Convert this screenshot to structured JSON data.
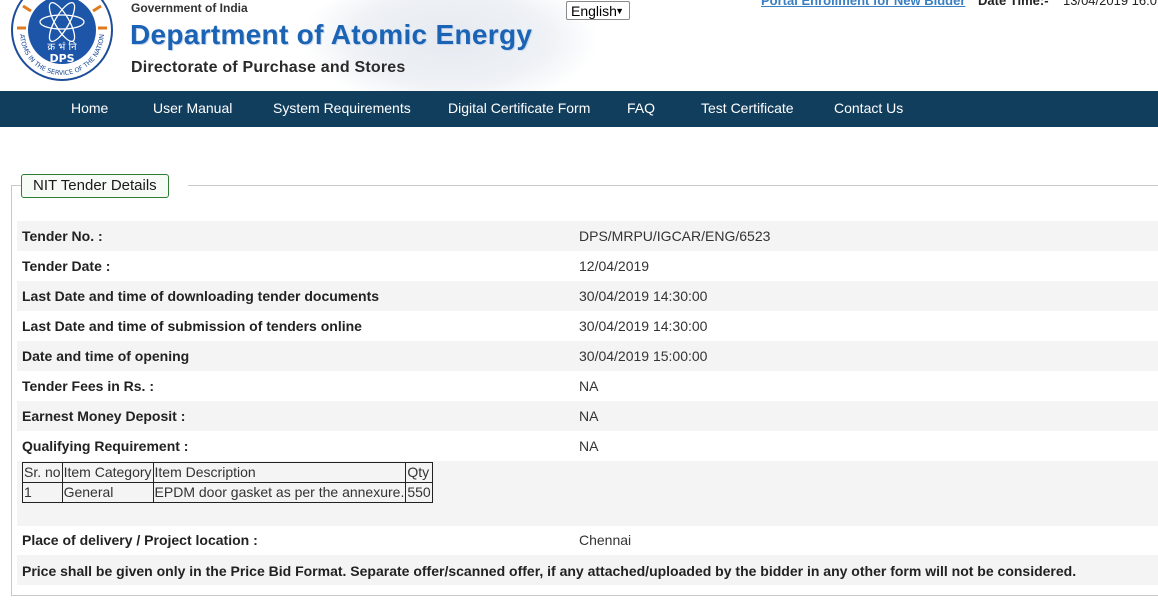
{
  "header": {
    "logo_text": "DPS",
    "logo_hindi": "क्र भं नि",
    "logo_arc_top": "परमाणु ऊर्जा राष्ट्र की सेवा में",
    "logo_arc_bottom": "ATOMS IN THE SERVICE OF THE NATION",
    "gov": "Government of India",
    "dept": "Department of Atomic Energy",
    "directorate": "Directorate of Purchase and Stores",
    "language": "English",
    "portal_link": "Portal Enrollment for New Bidder",
    "datetime_label": "Date Time:-",
    "datetime_value": "13/04/2019 16:0"
  },
  "nav": [
    "Home",
    "User Manual",
    "System Requirements",
    "Digital Certificate Form",
    "FAQ",
    "Test Certificate",
    "Contact Us"
  ],
  "section_title": "NIT Tender Details",
  "details": [
    {
      "label": "Tender No. :",
      "value": "DPS/MRPU/IGCAR/ENG/6523"
    },
    {
      "label": "Tender Date :",
      "value": "12/04/2019"
    },
    {
      "label": "Last Date and time of downloading tender documents",
      "value": "30/04/2019 14:30:00"
    },
    {
      "label": "Last Date and time of submission of tenders online",
      "value": "30/04/2019 14:30:00"
    },
    {
      "label": "Date and time of opening",
      "value": "30/04/2019 15:00:00"
    },
    {
      "label": "Tender Fees in Rs. :",
      "value": "NA"
    },
    {
      "label": "Earnest Money Deposit :",
      "value": "NA"
    },
    {
      "label": "Qualifying Requirement :",
      "value": "NA"
    }
  ],
  "items_table": {
    "headers": [
      "Sr. no",
      "Item Category",
      "Item Description",
      "Qty"
    ],
    "rows": [
      [
        "1",
        "General",
        "EPDM door gasket as per the annexure.",
        "550"
      ]
    ]
  },
  "delivery": {
    "label": "Place of delivery / Project location :",
    "value": "Chennai"
  },
  "note": "Price shall be given only in the Price Bid Format. Separate offer/scanned offer, if any attached/uploaded by the bidder in any other form will not be considered.",
  "colors": {
    "nav_bg": "#123e5e",
    "title_blue": "#1b63b4",
    "legend_border": "#2e7d32",
    "link": "#3a7fc1"
  }
}
